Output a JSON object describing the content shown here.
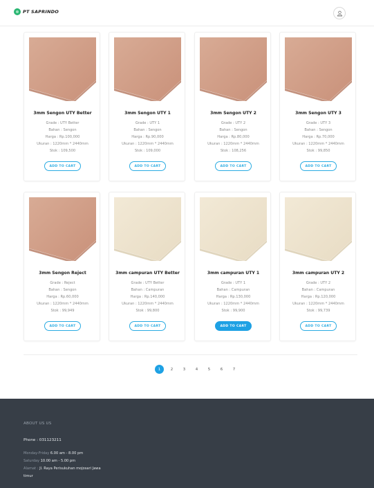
{
  "header": {
    "logo_text": "PT SAPRINDO",
    "brand_color": "#2bb673",
    "user_icon": "user-icon"
  },
  "products": [
    {
      "title": "3mm Sengon UTY Better",
      "grade": "Grade : UTY Better",
      "bahan": "Bahan : Sengon",
      "harga": "Harga : Rp.100,000",
      "ukuran": "Ukuran : 1220mm * 2440mm",
      "stok": "Stok : 109,500",
      "cart": "ADD TO CART",
      "wood": "sengon"
    },
    {
      "title": "3mm Sengon UTY 1",
      "grade": "Grade : UTY 1",
      "bahan": "Bahan : Sengon",
      "harga": "Harga : Rp.90,000",
      "ukuran": "Ukuran : 1220mm * 2440mm",
      "stok": "Stok : 109,000",
      "cart": "ADD TO CART",
      "wood": "sengon"
    },
    {
      "title": "3mm Sengon UTY 2",
      "grade": "Grade : UTY 2",
      "bahan": "Bahan : Sengon",
      "harga": "Harga : Rp.80,000",
      "ukuran": "Ukuran : 1220mm * 2440mm",
      "stok": "Stok : 108,256",
      "cart": "ADD TO CART",
      "wood": "sengon"
    },
    {
      "title": "3mm Sengon UTY 3",
      "grade": "Grade : UTY 3",
      "bahan": "Bahan : Sengon",
      "harga": "Harga : Rp.70,000",
      "ukuran": "Ukuran : 1220mm * 2440mm",
      "stok": "Stok : 99,850",
      "cart": "ADD TO CART",
      "wood": "sengon"
    },
    {
      "title": "3mm Sengon Reject",
      "grade": "Grade : Reject",
      "bahan": "Bahan : Sengon",
      "harga": "Harga : Rp.60,000",
      "ukuran": "Ukuran : 1220mm * 2440mm",
      "stok": "Stok : 99,949",
      "cart": "ADD TO CART",
      "wood": "sengon"
    },
    {
      "title": "3mm campuran UTY Better",
      "grade": "Grade : UTY Better",
      "bahan": "Bahan : Campuran",
      "harga": "Harga : Rp.140,000",
      "ukuran": "Ukuran : 1220mm * 2440mm",
      "stok": "Stok : 99,800",
      "cart": "ADD TO CART",
      "wood": "campuran"
    },
    {
      "title": "3mm campuran UTY 1",
      "grade": "Grade : UTY 1",
      "bahan": "Bahan : Campuran",
      "harga": "Harga : Rp.130,000",
      "ukuran": "Ukuran : 1220mm * 2440mm",
      "stok": "Stok : 99,900",
      "cart": "ADD TO CART",
      "wood": "campuran",
      "active": true
    },
    {
      "title": "3mm campuran UTY 2",
      "grade": "Grade : UTY 2",
      "bahan": "Bahan : Campuran",
      "harga": "Harga : Rp.120,000",
      "ukuran": "Ukuran : 1220mm * 2440mm",
      "stok": "Stok : 99,739",
      "cart": "ADD TO CART",
      "wood": "campuran"
    }
  ],
  "pagination": {
    "pages": [
      "1",
      "2",
      "3",
      "4",
      "5",
      "6",
      "7"
    ],
    "current": "1",
    "accent_color": "#1ea1e4"
  },
  "footer": {
    "about_heading": "ABOUT US US",
    "phone": "Phone : 031123211",
    "hours_weekday_label": "Monday-Friday",
    "hours_weekday": "6.00 am - 8.00 pm",
    "hours_saturday_label": "Saturday",
    "hours_saturday": "10.00 am - 5.00 pm",
    "address_label": "Alamat",
    "address": "Jl. Raya Perisukuhan mojosari Jawa",
    "address_line2": "timur",
    "background": "#373e47"
  }
}
